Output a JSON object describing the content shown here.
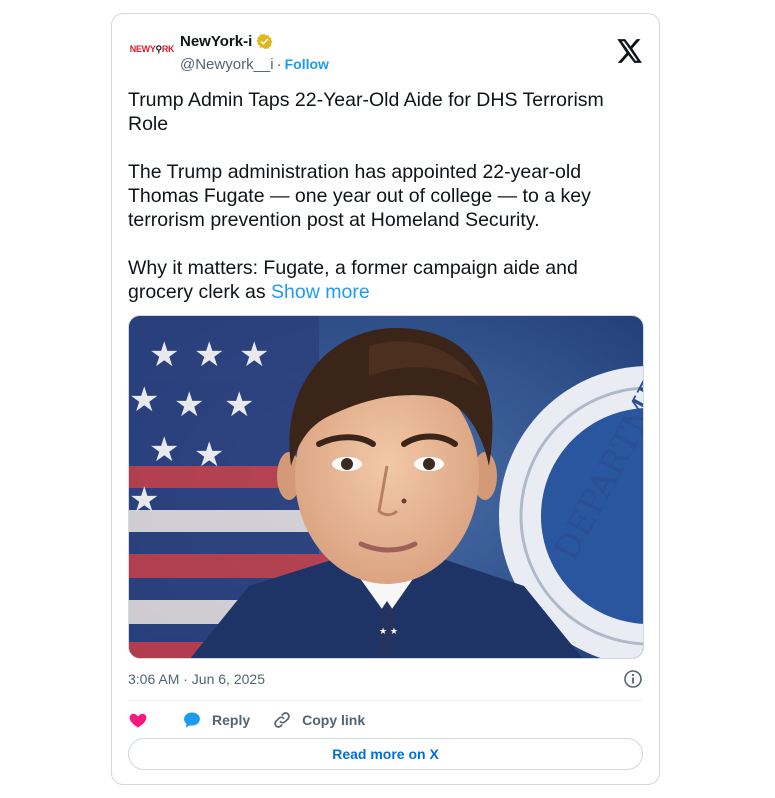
{
  "header": {
    "avatar_text": "NEWY",
    "avatar_text_2": "RK",
    "display_name": "NewYork-i",
    "handle": "@Newyork__i",
    "separator": "·",
    "follow_label": "Follow",
    "verified_icon": "verified-gold-badge-icon",
    "close_icon": "x-logo-icon"
  },
  "tweet": {
    "title": "Trump Admin Taps 22-Year-Old Aide for DHS Terrorism Role",
    "paragraph_1": "The Trump administration has appointed 22-year-old Thomas Fugate — one year out of college — to a key terrorism prevention post at Homeland Security.",
    "paragraph_2": "Why it matters: Fugate, a former campaign aide and grocery clerk as ",
    "show_more": "Show more",
    "timestamp": "3:06 AM · Jun 6, 2025"
  },
  "media": {
    "seal_text": "DEPARTME"
  },
  "actions": {
    "like_icon": "heart-icon",
    "reply_label": "Reply",
    "copy_label": "Copy link",
    "read_more_label": "Read more on X"
  },
  "colors": {
    "accent": "#1d9bf0",
    "link_dark": "#006fd6",
    "heart": "#f91880",
    "verified": "#e2b719"
  }
}
